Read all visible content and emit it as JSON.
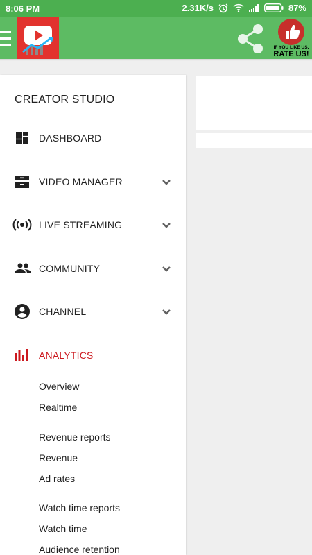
{
  "status": {
    "time": "8:06 PM",
    "speed": "2.31K/s",
    "battery": "87%"
  },
  "rate": {
    "small": "IF YOU LIKE US,",
    "big": "RATE US!"
  },
  "drawer": {
    "title": "CREATOR STUDIO",
    "items": [
      {
        "label": "DASHBOARD",
        "icon": "dashboard-icon"
      },
      {
        "label": "VIDEO MANAGER",
        "icon": "video-manager-icon"
      },
      {
        "label": "LIVE STREAMING",
        "icon": "live-streaming-icon"
      },
      {
        "label": "COMMUNITY",
        "icon": "community-icon"
      },
      {
        "label": "CHANNEL",
        "icon": "channel-icon"
      },
      {
        "label": "ANALYTICS",
        "icon": "analytics-icon"
      }
    ],
    "analytics_sub": [
      "Overview",
      "Realtime",
      "Revenue reports",
      "Revenue",
      "Ad rates",
      "Watch time reports",
      "Watch time",
      "Audience retention"
    ]
  },
  "colors": {
    "status_bar": "#4caf50",
    "app_bar": "#5dbb63",
    "active": "#cc181e",
    "logo": "#e2332e"
  }
}
